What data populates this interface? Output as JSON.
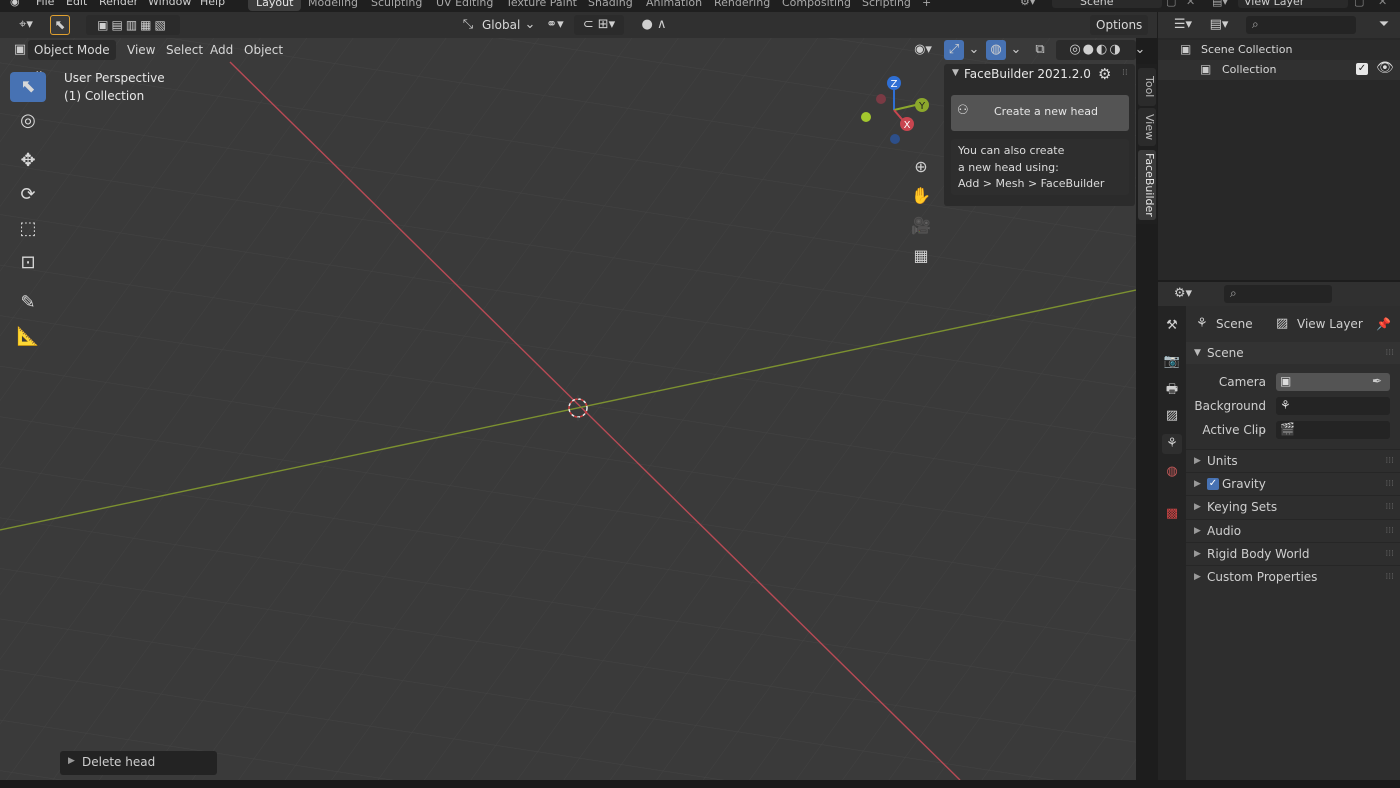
{
  "menubar": {
    "items": [
      "File",
      "Edit",
      "Render",
      "Window",
      "Help"
    ],
    "workspaces": [
      "Layout",
      "Modeling",
      "Sculpting",
      "UV Editing",
      "Texture Paint",
      "Shading",
      "Animation",
      "Rendering",
      "Compositing",
      "Scripting"
    ],
    "active_workspace": "Layout",
    "add_tab": "+",
    "scene_name": "Scene",
    "view_layer_name": "View Layer"
  },
  "viewport_header": {
    "transform_orientation": "Global",
    "options_label": "Options",
    "mode": "Object Mode",
    "menus": [
      "View",
      "Select",
      "Add",
      "Object"
    ]
  },
  "viewport": {
    "overlay_title": "User Perspective",
    "overlay_collection": "(1) Collection",
    "gizmo_axes": [
      "Z",
      "Y",
      "X"
    ],
    "axis_colors": {
      "x": "#c8454f",
      "y": "#8ca82c",
      "z": "#2f6fd4"
    }
  },
  "npanel": {
    "title": "FaceBuilder 2021.2.0",
    "create_button": "Create a new head",
    "info_lines": [
      "You can also create",
      "a new head using:",
      "Add > Mesh > FaceBuilder"
    ],
    "side_tabs": [
      "Tool",
      "View",
      "FaceBuilder"
    ]
  },
  "last_operator": {
    "label": "Delete head"
  },
  "outliner": {
    "root": "Scene Collection",
    "children": [
      "Collection"
    ]
  },
  "properties": {
    "context_scene": "Scene",
    "context_view_layer": "View Layer",
    "section_title": "Scene",
    "fields": [
      {
        "label": "Camera",
        "icon": "camera-icon"
      },
      {
        "label": "Background ...",
        "icon": "scene-icon"
      },
      {
        "label": "Active Clip",
        "icon": "clip-icon"
      }
    ],
    "panels": [
      "Units",
      "Gravity",
      "Keying Sets",
      "Audio",
      "Rigid Body World",
      "Custom Properties"
    ],
    "gravity_checked": true
  }
}
